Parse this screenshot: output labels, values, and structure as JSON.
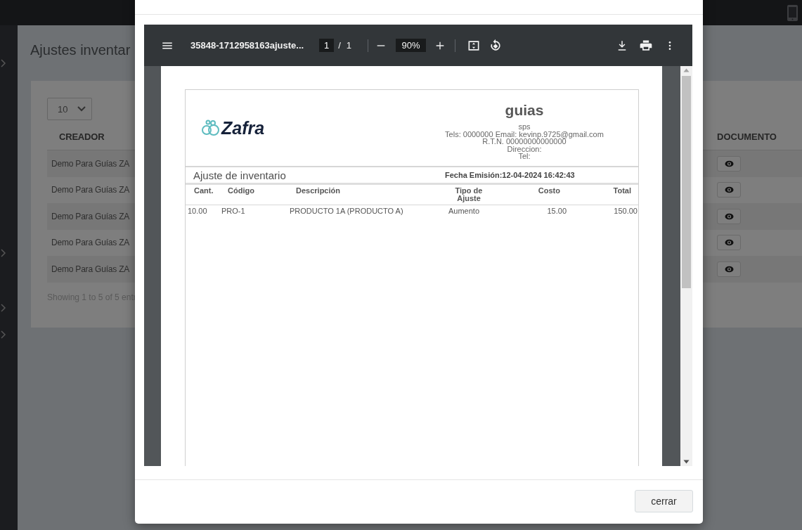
{
  "background_page": {
    "title": "Ajustes inventar",
    "page_size": "10",
    "columns": [
      "CREADOR",
      "DOCUMENTO"
    ],
    "rows": [
      {
        "creator": "Demo Para Guías ZA"
      },
      {
        "creator": "Demo Para Guías ZA"
      },
      {
        "creator": "Demo Para Guías ZA"
      },
      {
        "creator": "Demo Para Guías ZA"
      },
      {
        "creator": "Demo Para Guías ZA"
      }
    ],
    "info": "Showing 1 to 5 of 5 entr"
  },
  "dialog": {
    "pdf_viewer": {
      "file_name": "35848-1712958163ajuste...",
      "page_current": "1",
      "page_separator": "/",
      "page_total": "1",
      "zoom": "90%",
      "document": {
        "logo_text": "Zafra",
        "company": "guias",
        "company_lines": [
          "sps",
          "Tels: 0000000 Email: kevinp.9725@gmail.com",
          "R.T.N. 00000000000000",
          "Direccion:",
          "Tel:"
        ],
        "title": "Ajuste de inventario",
        "issue_date": "Fecha Emisión:12-04-2024 16:42:43",
        "table": {
          "columns": [
            "Cant.",
            "Código",
            "Descripción",
            "Tipo de Ajuste",
            "Costo",
            "Total"
          ],
          "rows": [
            [
              "10.00",
              "PRO-1",
              "PRODUCTO 1A (PRODUCTO A)",
              "Aumento",
              "15.00",
              "150.00"
            ]
          ]
        }
      }
    },
    "buttons": [
      "cerrar"
    ]
  }
}
